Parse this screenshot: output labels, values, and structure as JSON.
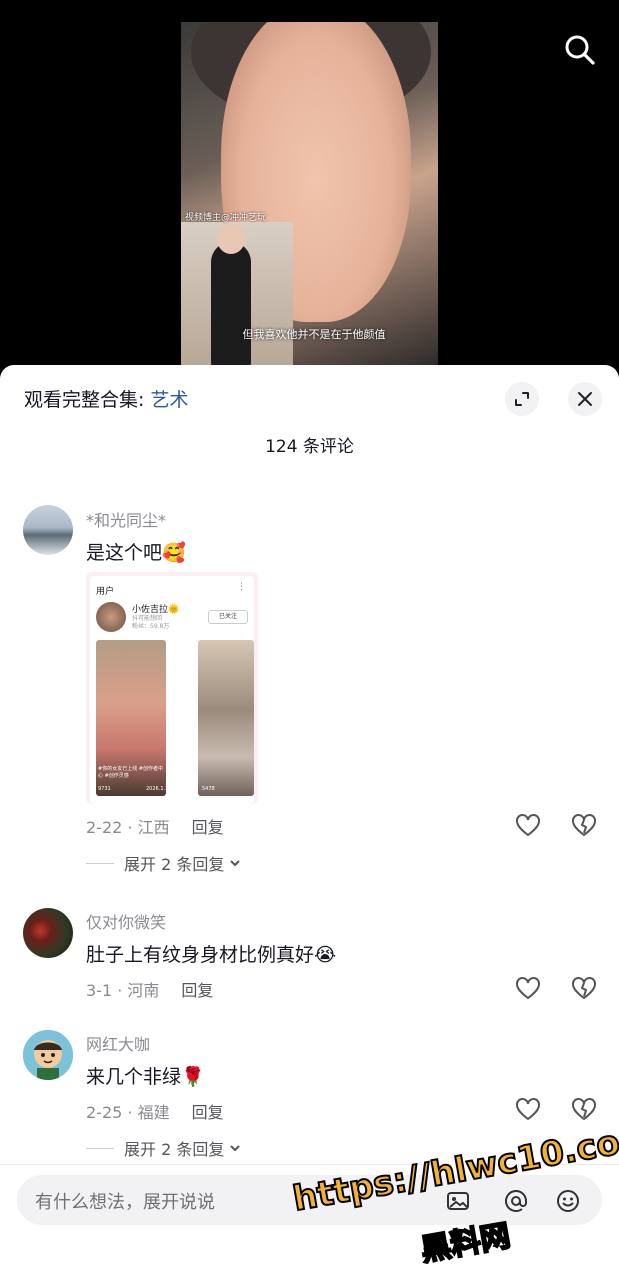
{
  "video": {
    "watermark": "视频博主@冲冲艺玩",
    "caption": "但我喜欢他并不是在于他颜值"
  },
  "sheet": {
    "collection_prefix": "观看完整合集: ",
    "collection_name": "艺术",
    "comment_count": "124 条评论"
  },
  "comments": [
    {
      "user": "*和光同尘*",
      "text": "是这个吧🥰",
      "date_location": "2-22 · 江西",
      "reply": "回复",
      "expand": "展开 2 条回复",
      "attachment": {
        "title": "用户",
        "name": "小佐吉拉🌞",
        "sub1": "抖可能想回",
        "sub2": "粉丝：59.8万",
        "follow": "已关注",
        "tag": "#你的女友已上线 #创作者中心 #创作灵感",
        "likes1": "9731",
        "date1": "2026.1.30",
        "likes2": "5478"
      }
    },
    {
      "user": "仅对你微笑",
      "text": "肚子上有纹身身材比例真好😭",
      "date_location": "3-1 · 河南",
      "reply": "回复"
    },
    {
      "user": "网红大咖",
      "text": "来几个非绿🌹",
      "date_location": "2-25 · 福建",
      "reply": "回复",
      "expand": "展开 2 条回复"
    }
  ],
  "input": {
    "placeholder": "有什么想法，展开说说"
  },
  "overlay": {
    "site_line1": "https://hlwc10.com",
    "site_line2": "黑料网"
  },
  "colors": {
    "accent": "#2b5b9e",
    "text": "#161823",
    "muted": "#8a8b91"
  }
}
